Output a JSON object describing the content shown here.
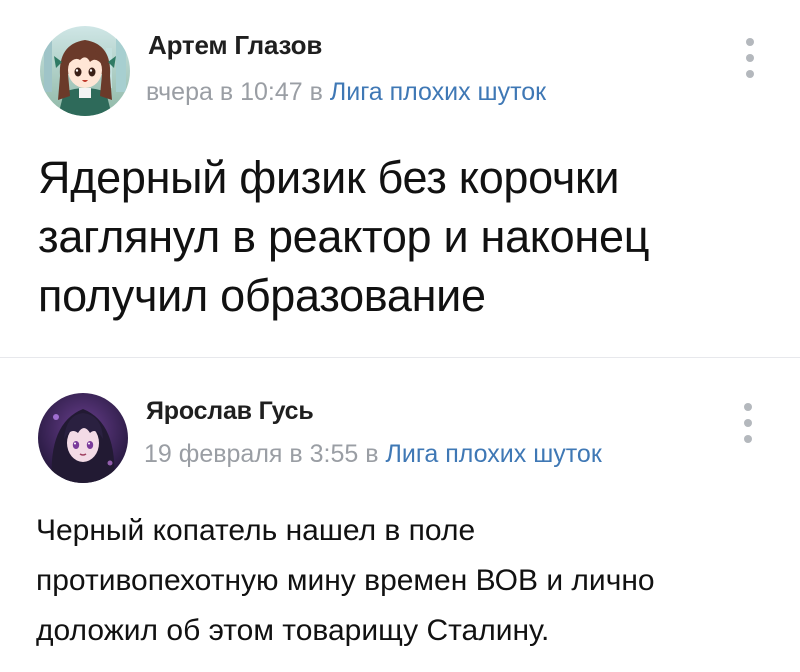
{
  "posts": [
    {
      "author": "Артем Глазов",
      "date_prefix": "вчера в 10:47",
      "in_word": "в",
      "group": "Лига плохих шуток",
      "text_lines": [
        "Ядерный физик без корочки",
        "заглянул в реактор и наконец",
        "получил образование"
      ],
      "avatar_icon": "anime-girl-avatar"
    },
    {
      "author": "Ярослав Гусь",
      "date_prefix": "19 февраля в 3:55",
      "in_word": "в",
      "group": "Лига плохих шуток",
      "text_lines": [
        "Черный копатель нашел в поле",
        "противопехотную мину времен ВОВ и лично",
        "доложил об этом товарищу Сталину."
      ],
      "avatar_icon": "dark-haired-anime-avatar"
    }
  ],
  "colors": {
    "link": "#3f78b5",
    "meta": "#9a9ea4",
    "separator": "#e7e8ec",
    "menu_dots": "#b4b8bd"
  },
  "icons": {
    "menu": "more-vertical-icon"
  }
}
